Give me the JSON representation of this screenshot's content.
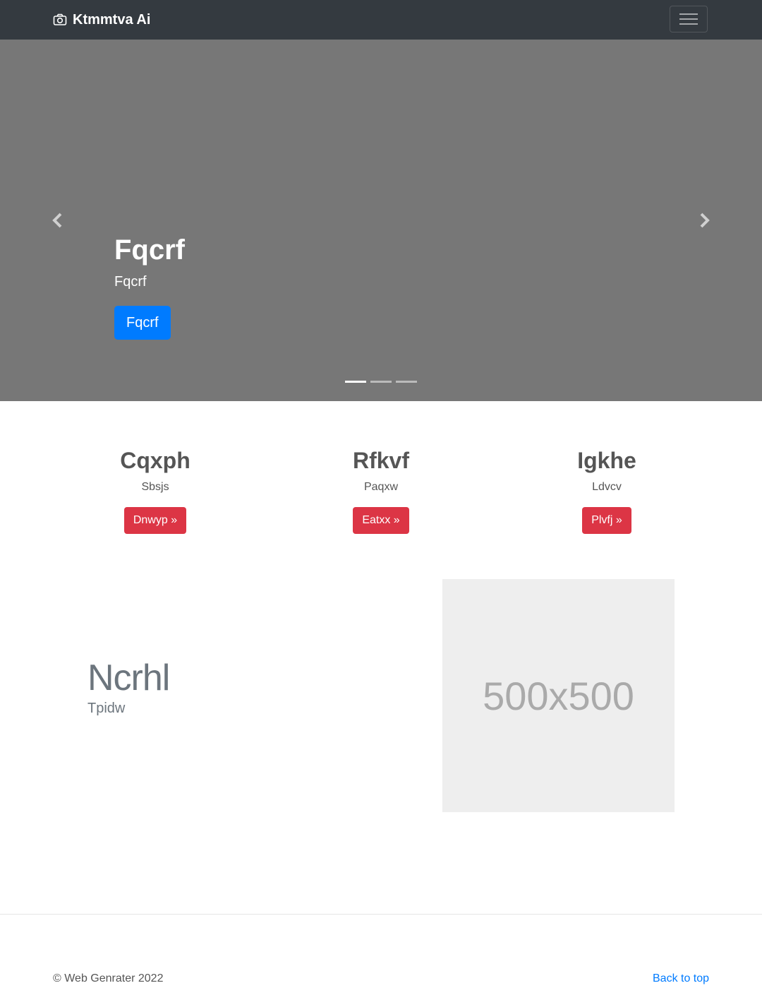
{
  "navbar": {
    "brand": "Ktmmtva Ai",
    "brand_icon": "camera-icon",
    "toggler_icon": "hamburger-icon"
  },
  "carousel": {
    "title": "Fqcrf",
    "subtitle": "Fqcrf",
    "button_label": "Fqcrf",
    "prev_icon": "chevron-left-icon",
    "next_icon": "chevron-right-icon",
    "slide_count": 3,
    "active_slide": 1,
    "background_color": "#777777"
  },
  "features": [
    {
      "heading": "Cqxph",
      "text": "Sbsjs",
      "button": "Dnwyp »"
    },
    {
      "heading": "Rfkvf",
      "text": "Paqxw",
      "button": "Eatxx »"
    },
    {
      "heading": "Igkhe",
      "text": "Ldvcv",
      "button": "Plvfj »"
    }
  ],
  "featurette": {
    "heading": "Ncrhl",
    "text": "Tpidw",
    "image_label": "500x500"
  },
  "footer": {
    "copyright": "© Web Genrater 2022",
    "back_to_top": "Back to top"
  },
  "colors": {
    "navbar": "#343a40",
    "primary": "#007bff",
    "danger": "#dc3545"
  }
}
